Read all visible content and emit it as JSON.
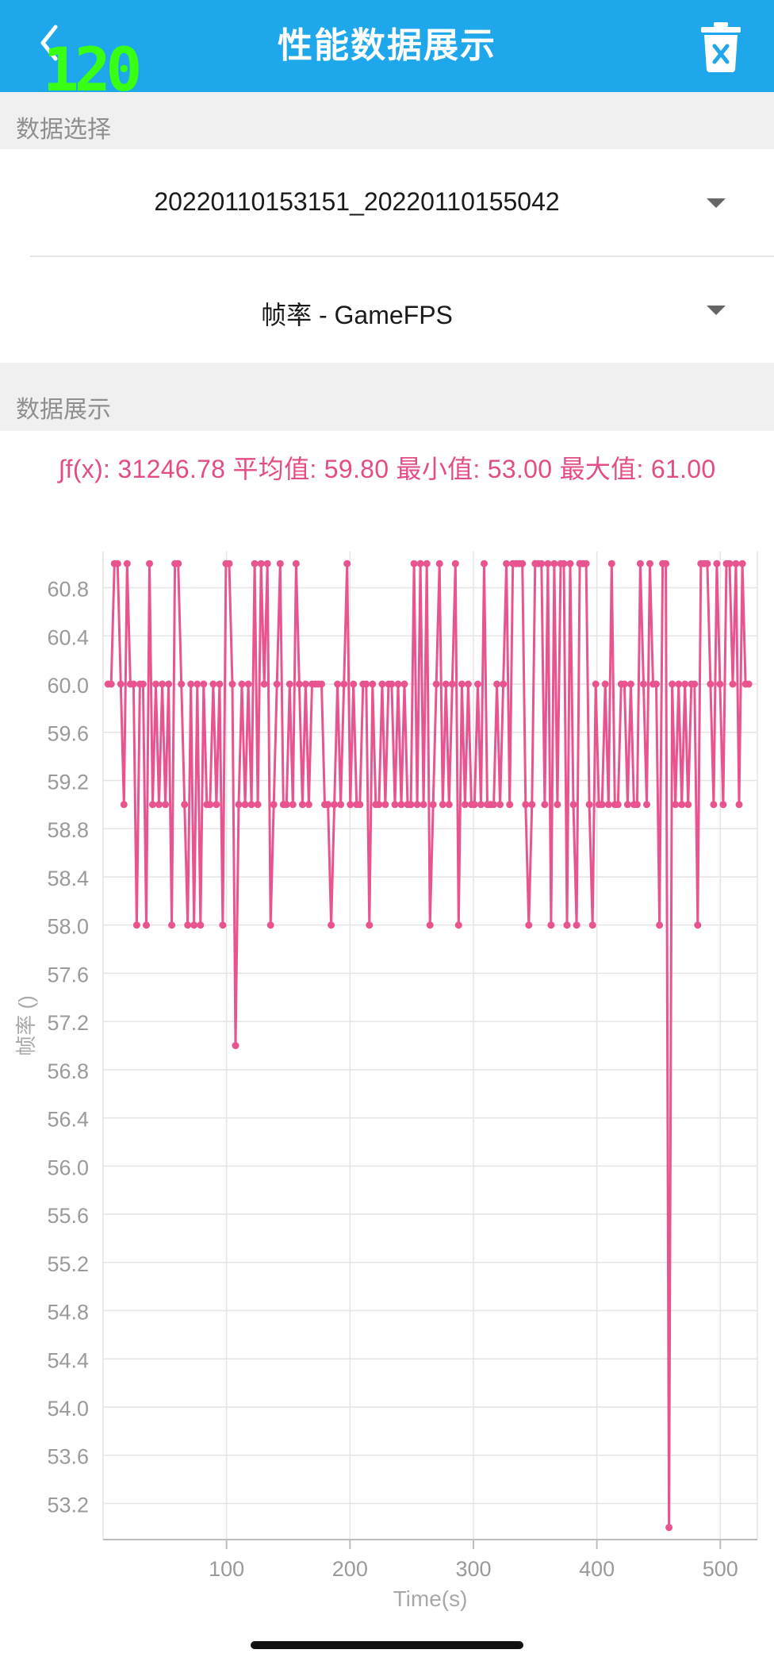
{
  "header": {
    "title": "性能数据展示",
    "fps_overlay": "120",
    "back_icon": "chevron-left-icon",
    "delete_icon": "trash-icon",
    "bar_color": "#1ea7ea"
  },
  "data_select": {
    "section_title": "数据选择",
    "session_value": "20220110153151_20220110155042",
    "metric_value": "帧率 - GameFPS"
  },
  "data_display": {
    "section_title": "数据展示",
    "stats_text": "∫f(x): 31246.78 平均值: 59.80 最小值: 53.00 最大值: 61.00"
  },
  "chart_data": {
    "type": "line",
    "xlabel": "Time(s)",
    "ylabel": "帧率 ()",
    "xlim": [
      0,
      530
    ],
    "ylim": [
      52.9,
      61.1
    ],
    "x_ticks": [
      100,
      200,
      300,
      400,
      500
    ],
    "y_ticks": [
      53.2,
      53.6,
      54.0,
      54.4,
      54.8,
      55.2,
      55.6,
      56.0,
      56.4,
      56.8,
      57.2,
      57.6,
      58.0,
      58.4,
      58.8,
      59.2,
      59.6,
      60.0,
      60.4,
      60.8
    ],
    "grid": true,
    "line_color": "#e8548f",
    "series": [
      {
        "values": [
          60,
          60,
          61,
          61,
          60,
          59,
          61,
          60,
          60,
          58,
          60,
          60,
          58,
          61,
          59,
          60,
          59,
          60,
          59,
          60,
          58,
          61,
          61,
          60,
          59,
          58,
          60,
          58,
          60,
          58,
          60,
          59,
          59,
          60,
          59,
          60,
          58,
          61,
          61,
          60,
          57,
          59,
          60,
          59,
          60,
          59,
          61,
          59,
          61,
          60,
          61,
          58,
          59,
          60,
          61,
          59,
          59,
          60,
          59,
          61,
          60,
          59,
          60,
          59,
          60,
          60,
          60,
          60,
          59,
          59,
          58,
          59,
          60,
          59,
          60,
          61,
          59,
          60,
          59,
          59,
          60,
          60,
          58,
          60,
          59,
          59,
          60,
          59,
          60,
          60,
          59,
          60,
          59,
          60,
          59,
          59,
          61,
          59,
          61,
          59,
          61,
          58,
          59,
          60,
          61,
          59,
          60,
          59,
          60,
          61,
          58,
          60,
          59,
          60,
          59,
          59,
          60,
          59,
          61,
          59,
          59,
          59,
          60,
          59,
          60,
          61,
          59,
          61,
          61,
          61,
          61,
          59,
          58,
          59,
          61,
          61,
          61,
          59,
          61,
          58,
          61,
          59,
          61,
          61,
          58,
          61,
          59,
          58,
          61,
          61,
          61,
          59,
          58,
          60,
          59,
          59,
          60,
          59,
          61,
          59,
          59,
          60,
          60,
          59,
          60,
          59,
          59,
          61,
          60,
          59,
          61,
          60,
          60,
          58,
          61,
          61,
          53,
          60,
          59,
          60,
          59,
          60,
          59,
          60,
          60,
          58,
          61,
          61,
          61,
          60,
          59,
          61,
          60,
          59,
          61,
          61,
          60,
          61,
          59,
          61,
          60,
          60
        ]
      }
    ]
  }
}
